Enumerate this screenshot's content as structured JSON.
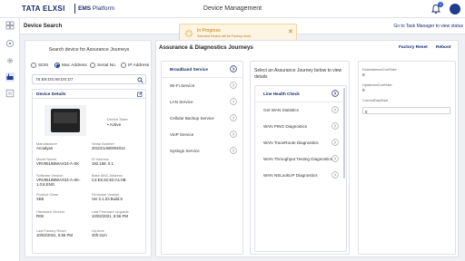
{
  "header": {
    "brand": "TATA ELXSI",
    "platform_bold": "EMS",
    "platform_rest": " Platform",
    "title": "Device Management",
    "notification_count": "1"
  },
  "toast": {
    "title": "In Progress",
    "message": "Selected Device will be Factory reset",
    "close": "✕"
  },
  "subheader": {
    "title": "Device Search",
    "task_link": "Go to Task Manager to view status"
  },
  "search": {
    "label": "Search device for Assurance Journeys",
    "radios": [
      {
        "label": "SDSI",
        "selected": false
      },
      {
        "label": "Mac Address",
        "selected": true
      },
      {
        "label": "Serial No.",
        "selected": false
      },
      {
        "label": "IP Address",
        "selected": false
      }
    ],
    "value": "76:B9:D5:99:D0:D7"
  },
  "device": {
    "title": "Device Details",
    "state_label": "Device State",
    "state_value": "• Active",
    "fields": [
      {
        "label": "Manufacturer",
        "value": "Arcadyan"
      },
      {
        "label": "Serial Number",
        "value": "201021AB0004014"
      },
      {
        "label": "Model Name",
        "value": "VRV9519BWAX34-A-SK"
      },
      {
        "label": "IP Address",
        "value": "192.168. 0.1"
      },
      {
        "label": "Software Version",
        "value": "VRV9519BWAX34-A-SK-1.0.8.ENG"
      },
      {
        "label": "Base MAC Address",
        "value": "C4:E5:32:4D:A1:0B"
      },
      {
        "label": "Product Class",
        "value": "XB6"
      },
      {
        "label": "Firmware Version",
        "value": "Ver 2.1.03 Build 6"
      },
      {
        "label": "Hardware Version",
        "value": "R08"
      },
      {
        "label": "Last Firmware Upgrade",
        "value": "10/02/2021, 5:56 PM"
      },
      {
        "label": "Last Factory Reset",
        "value": "10/02/2021, 5:56 PM"
      },
      {
        "label": "Up-time",
        "value": "20h:41m"
      }
    ]
  },
  "main": {
    "title": "Assurance & Diagnostics Journeys",
    "factory_reset": "Factory Reset",
    "reboot": "Reboot",
    "categories": [
      {
        "label": "Broadband Service",
        "selected": true
      },
      {
        "label": "Wi-Fi Service",
        "selected": false
      },
      {
        "label": "LAN Service",
        "selected": false
      },
      {
        "label": "Cellular Backup Service",
        "selected": false
      },
      {
        "label": "VoIP Service",
        "selected": false
      },
      {
        "label": "Syslogs Service",
        "selected": false
      }
    ],
    "journey_header": "Select an Assurance Journey below to view details",
    "journeys": [
      {
        "label": "Line Health Check",
        "selected": true
      },
      {
        "label": "Get WAN Statistics",
        "selected": false
      },
      {
        "label": "WAN PING Diagnostics",
        "selected": false
      },
      {
        "label": "WAN TraceRoute Diagnostics",
        "selected": false
      },
      {
        "label": "WAN Throughput Testing Diagnostics",
        "selected": false
      },
      {
        "label": "WAN NSLookUP Diagnostics",
        "selected": false
      }
    ],
    "results": [
      {
        "label": "DownstreamCurrRate",
        "value": "0"
      },
      {
        "label": "UpstreamCurrRate",
        "value": "0"
      },
      {
        "label": "CurrentDayStart",
        "value": "0"
      }
    ]
  },
  "colors": {
    "brand_navy": "#1b2b6b",
    "toast_bg": "#fdf4e2",
    "toast_text": "#c77a00"
  }
}
